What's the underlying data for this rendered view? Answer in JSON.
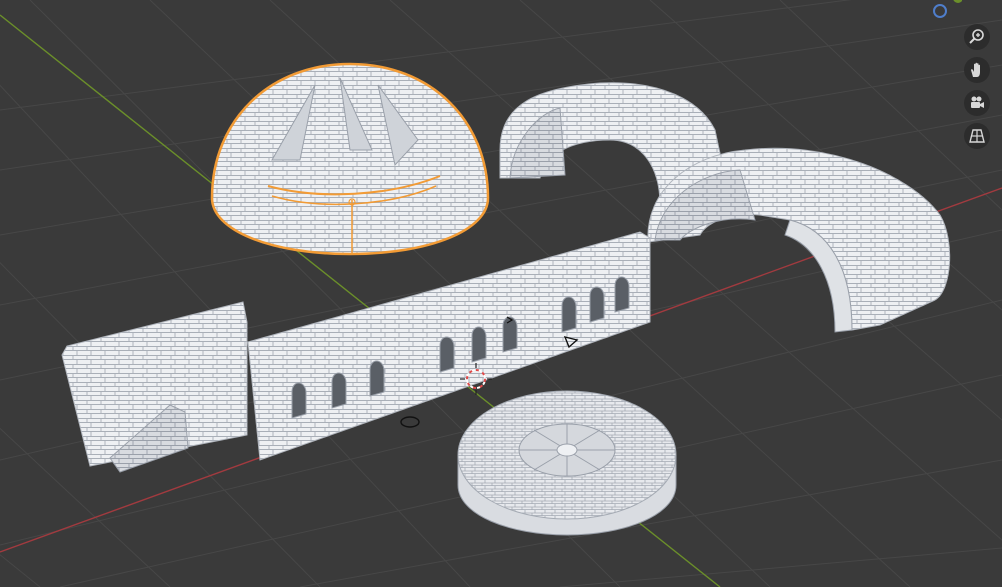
{
  "app": {
    "name": "3D viewport",
    "selected_object": "dome"
  },
  "colors": {
    "background": "#3a3a3a",
    "grid_line": "#4a4a4a",
    "x_axis": "#a23a3f",
    "y_axis": "#6b8f2a",
    "selection_outline": "#f29b35",
    "mesh_fill": "#eef0f3",
    "mesh_edge": "#a7adb6"
  },
  "objects": [
    {
      "kind": "dome",
      "selected": true
    },
    {
      "kind": "arch-vault",
      "selected": false
    },
    {
      "kind": "arch-vault",
      "selected": false
    },
    {
      "kind": "wall-with-stairs",
      "selected": false
    },
    {
      "kind": "wall-with-windows",
      "selected": false
    },
    {
      "kind": "round-floor-disc",
      "selected": false
    }
  ],
  "nav_tools": [
    {
      "name": "zoom",
      "icon": "zoom-icon"
    },
    {
      "name": "pan",
      "icon": "hand-icon"
    },
    {
      "name": "camera",
      "icon": "camera-icon"
    },
    {
      "name": "perspective",
      "icon": "grid-icon"
    }
  ]
}
